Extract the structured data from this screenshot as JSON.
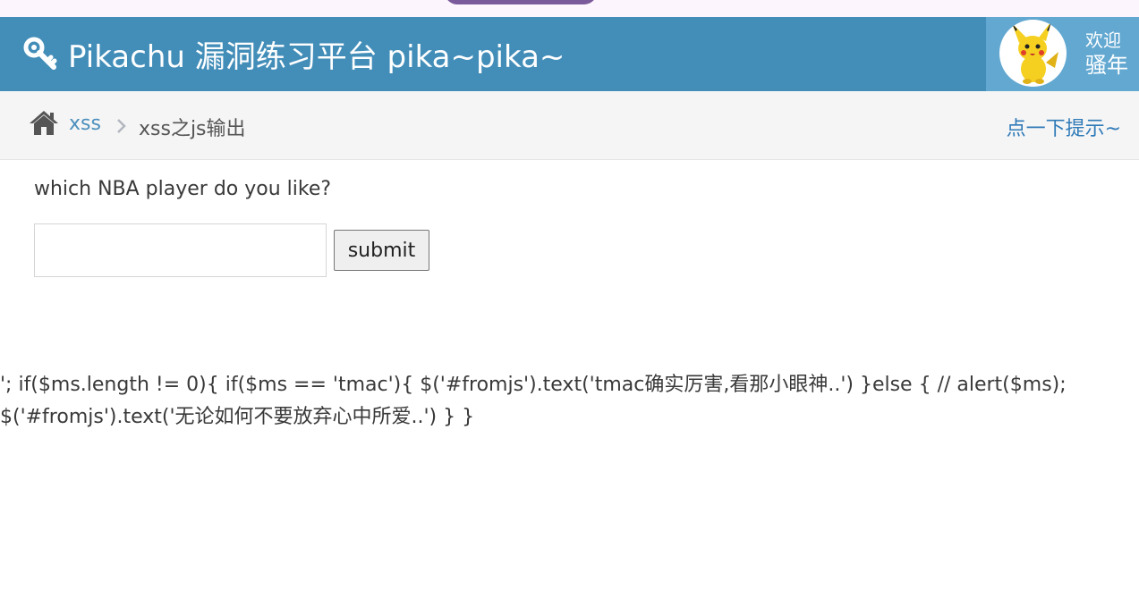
{
  "header": {
    "title": "Pikachu 漏洞练习平台 pika~pika~",
    "welcome": "欢迎",
    "username": "骚年",
    "colors": {
      "navbar": "#438eb9",
      "user_box": "#62a8d1"
    }
  },
  "breadcrumb": {
    "category": "xss",
    "current": "xss之js输出",
    "hint": "点一下提示~"
  },
  "form": {
    "question": "which NBA player do you like?",
    "input_value": "",
    "submit_label": "submit"
  },
  "output": {
    "line1": "'; if($ms.length != 0){ if($ms == 'tmac'){ $('#fromjs').text('tmac确实厉害,看那小眼神..') }else { // alert($ms);",
    "line2": "$('#fromjs').text('无论如何不要放弃心中所爱..') } }"
  }
}
